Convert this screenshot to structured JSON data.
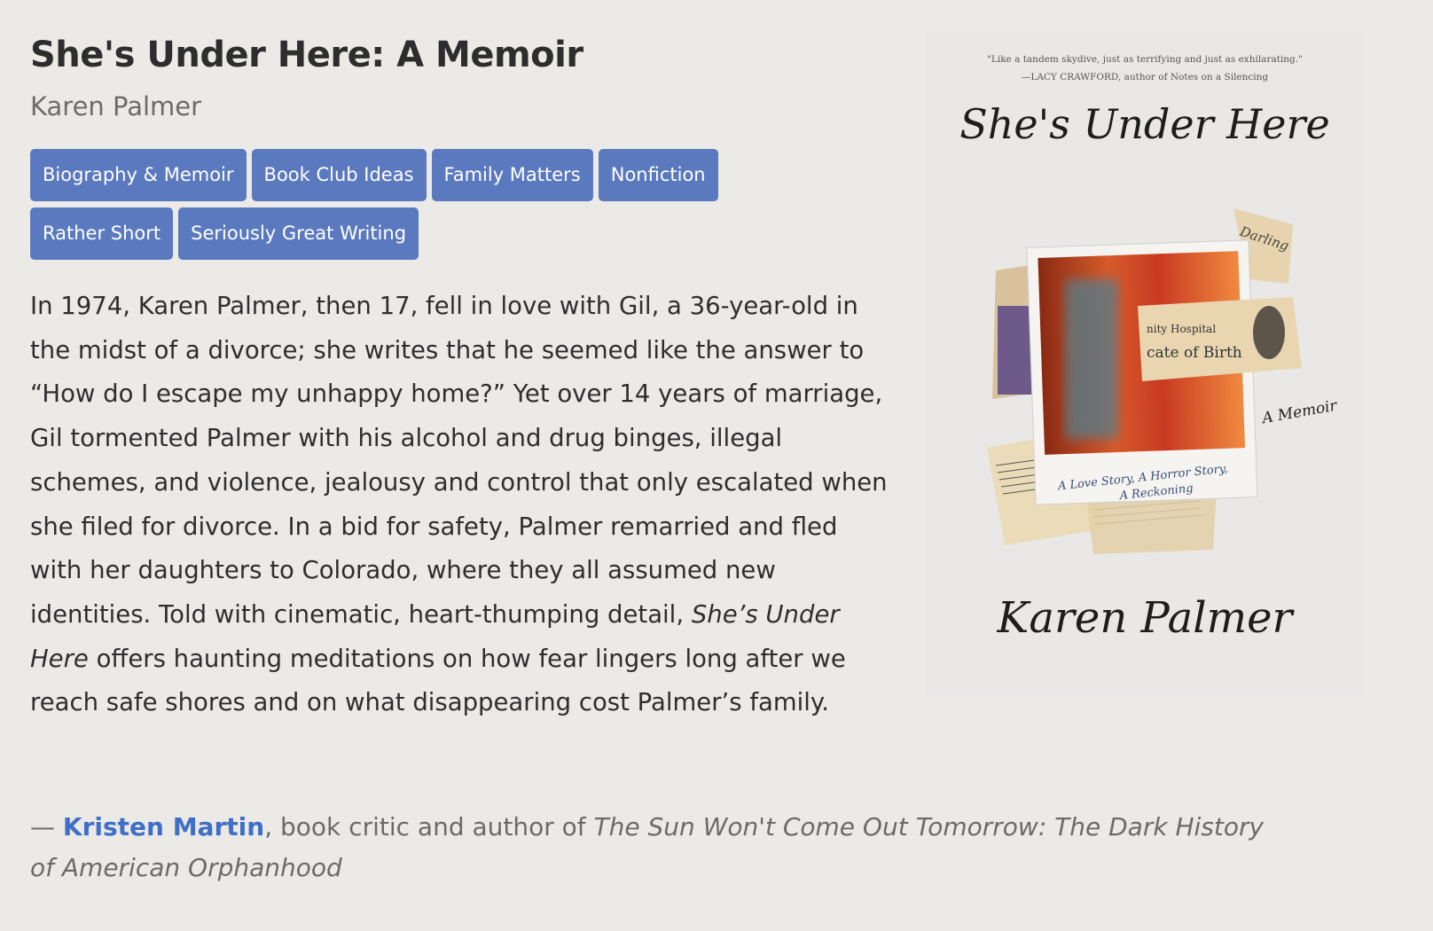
{
  "book": {
    "title": "She's Under Here: A Memoir",
    "author": "Karen Palmer"
  },
  "tags": [
    "Biography & Memoir",
    "Book Club Ideas",
    "Family Matters",
    "Nonfiction",
    "Rather Short",
    "Seriously Great Writing"
  ],
  "description": {
    "before_italic": "In 1974, Karen Palmer, then 17, fell in love with Gil, a 36-year-old in the midst of a divorce; she writes that he seemed like the answer to “How do I escape my unhappy home?” Yet over 14 years of marriage, Gil tormented Palmer with his alcohol and drug binges, illegal schemes, and violence, jealousy and control that only escalated when she filed for divorce. In a bid for safety, Palmer remarried and fled with her daughters to Colorado, where they all assumed new identities. Told with cinematic, heart-thumping detail, ",
    "italic": "She’s Under Here",
    "after_italic": " offers haunting meditations on how fear lingers long after we reach safe shores and on what disappearing cost Palmer’s family."
  },
  "credit": {
    "dash": "— ",
    "name": "Kristen Martin",
    "middle": ", book critic and author of ",
    "book_title": "The Sun Won't Come Out Tomorrow: The Dark History of American Orphanhood"
  },
  "cover": {
    "blurb_line1": "\"Like a tandem skydive, just as terrifying and just as exhilarating.\"",
    "blurb_line2": "—LACY CRAWFORD, author of Notes on a Silencing",
    "title": "She's Under Here",
    "subtitle": "A Memoir",
    "caption_line1": "A Love Story, A Horror Story,",
    "caption_line2": "A Reckoning",
    "certificate_line1": "nity Hospital",
    "certificate_line2": "cate of Birth",
    "note": "Darling",
    "author": "Karen Palmer"
  },
  "colors": {
    "background": "#ebeae6",
    "tag_background": "#5b79bf",
    "link": "#3f6fc8"
  }
}
